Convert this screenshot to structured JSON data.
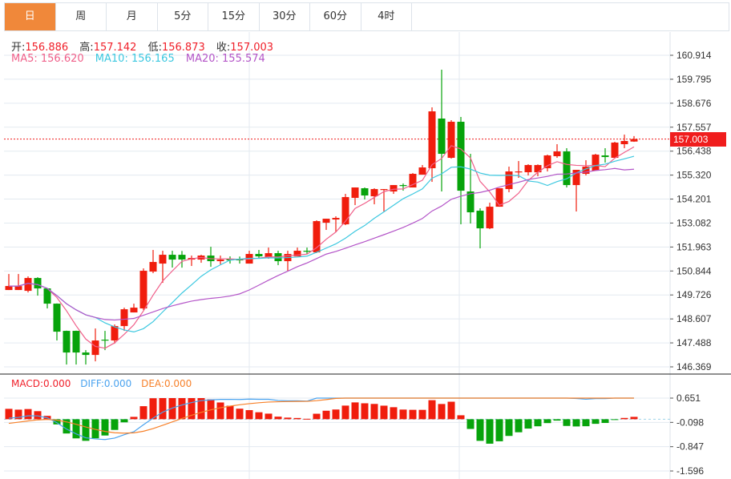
{
  "tabs": [
    {
      "label": "日",
      "active": true
    },
    {
      "label": "周"
    },
    {
      "label": "月"
    },
    {
      "label": "5分"
    },
    {
      "label": "15分"
    },
    {
      "label": "30分"
    },
    {
      "label": "60分"
    },
    {
      "label": "4时"
    }
  ],
  "ohlc": {
    "open_label": "开:",
    "open": "156.886",
    "high_label": "高:",
    "high": "157.142",
    "low_label": "低:",
    "low": "156.873",
    "close_label": "收:",
    "close": "157.003"
  },
  "ma": {
    "ma5": "MA5: 156.620",
    "ma10": "MA10: 156.165",
    "ma20": "MA20: 155.574"
  },
  "macd_legend": {
    "macd": "MACD:0.000",
    "diff": "DIFF:0.000",
    "dea": "DEA:0.000"
  },
  "current_price": "157.003",
  "colors": {
    "up": "#f01d0d",
    "down": "#07a30b",
    "ma5": "#f0608a",
    "ma10": "#3cc8e0",
    "ma20": "#b455c8",
    "diff": "#4aa3ef",
    "dea": "#f7812a",
    "accent": "#f0883a"
  },
  "chart_data": {
    "type": "candlestick",
    "price_axis": {
      "ticks": [
        "160.914",
        "159.795",
        "158.676",
        "157.557",
        "156.438",
        "155.320",
        "154.201",
        "153.082",
        "151.963",
        "150.844",
        "149.726",
        "148.607",
        "147.488",
        "146.369"
      ],
      "range": [
        146.369,
        160.914
      ]
    },
    "macd_axis": {
      "ticks": [
        "0.651",
        "-0.098",
        "-0.847",
        "-1.596"
      ],
      "range": [
        -1.596,
        0.651
      ]
    },
    "candles": [
      [
        149.956,
        150.704,
        149.956,
        150.143
      ],
      [
        149.956,
        150.704,
        149.956,
        150.14
      ],
      [
        149.918,
        150.592,
        149.843,
        150.517
      ],
      [
        150.517,
        150.554,
        149.694,
        150.031
      ],
      [
        150.031,
        150.05,
        149.096,
        149.32
      ],
      [
        149.32,
        149.33,
        147.6,
        148.011
      ],
      [
        148.049,
        148.06,
        146.478,
        147.039
      ],
      [
        148.05,
        148.06,
        146.478,
        147.039
      ],
      [
        147.039,
        147.151,
        146.478,
        146.926
      ],
      [
        146.926,
        148.161,
        146.627,
        147.6
      ],
      [
        147.637,
        148.049,
        147.151,
        147.6
      ],
      [
        147.6,
        148.348,
        147.45,
        148.273
      ],
      [
        148.273,
        149.133,
        148.049,
        149.058
      ],
      [
        148.909,
        149.32,
        148.909,
        149.133
      ],
      [
        149.096,
        150.966,
        149.021,
        150.854
      ],
      [
        150.816,
        151.826,
        150.741,
        151.265
      ],
      [
        151.19,
        151.789,
        150.292,
        151.602
      ],
      [
        151.602,
        151.789,
        151.004,
        151.377
      ],
      [
        151.6,
        151.78,
        151.0,
        151.38
      ],
      [
        151.377,
        151.564,
        151.078,
        151.452
      ],
      [
        151.377,
        151.602,
        151.228,
        151.564
      ],
      [
        151.564,
        151.975,
        151.041,
        151.303
      ],
      [
        151.303,
        151.564,
        151.153,
        151.377
      ],
      [
        151.415,
        151.527,
        151.19,
        151.34
      ],
      [
        151.41,
        151.52,
        151.19,
        151.34
      ],
      [
        151.19,
        151.789,
        151.19,
        151.639
      ],
      [
        151.639,
        151.826,
        151.452,
        151.527
      ],
      [
        151.489,
        151.938,
        151.415,
        151.676
      ],
      [
        151.676,
        151.789,
        151.116,
        151.303
      ],
      [
        151.303,
        151.789,
        150.854,
        151.639
      ],
      [
        151.527,
        151.938,
        151.527,
        151.789
      ],
      [
        151.789,
        151.938,
        151.639,
        151.751
      ],
      [
        151.714,
        153.21,
        151.68,
        153.172
      ],
      [
        153.097,
        153.284,
        152.761,
        153.284
      ],
      [
        153.247,
        153.397,
        152.649,
        153.322
      ],
      [
        153.023,
        154.444,
        152.985,
        154.294
      ],
      [
        154.257,
        154.743,
        153.92,
        154.743
      ],
      [
        154.706,
        154.743,
        154.182,
        154.369
      ],
      [
        154.332,
        154.706,
        153.958,
        154.668
      ],
      [
        154.631,
        154.668,
        153.621,
        154.668
      ],
      [
        154.556,
        154.855,
        154.444,
        154.855
      ],
      [
        154.855,
        154.93,
        154.593,
        154.818
      ],
      [
        154.743,
        155.416,
        154.743,
        155.379
      ],
      [
        155.341,
        155.79,
        155.341,
        155.678
      ],
      [
        155.641,
        158.483,
        155.005,
        158.296
      ],
      [
        157.96,
        160.241,
        154.556,
        156.314
      ],
      [
        156.127,
        157.885,
        156.089,
        157.81
      ],
      [
        157.81,
        158.034,
        153.023,
        154.593
      ],
      [
        154.556,
        156.314,
        153.06,
        153.584
      ],
      [
        153.658,
        153.771,
        151.901,
        152.836
      ],
      [
        152.836,
        154.032,
        152.798,
        153.845
      ],
      [
        153.845,
        154.706,
        153.845,
        154.706
      ],
      [
        154.668,
        155.715,
        154.519,
        155.491
      ],
      [
        155.454,
        155.977,
        155.192,
        155.491
      ],
      [
        155.454,
        155.828,
        155.304,
        155.79
      ],
      [
        155.45,
        155.82,
        155.27,
        155.79
      ],
      [
        155.641,
        156.276,
        155.491,
        156.239
      ],
      [
        156.202,
        156.763,
        156.127,
        156.426
      ],
      [
        156.426,
        156.576,
        154.743,
        154.855
      ],
      [
        154.855,
        155.566,
        153.621,
        155.566
      ],
      [
        155.379,
        156.015,
        155.304,
        155.715
      ],
      [
        155.528,
        156.314,
        155.528,
        156.276
      ],
      [
        156.239,
        156.576,
        155.902,
        156.164
      ],
      [
        156.127,
        156.875,
        156.127,
        156.838
      ],
      [
        156.763,
        157.211,
        156.576,
        156.912
      ],
      [
        156.886,
        157.142,
        156.873,
        157.003
      ]
    ]
  }
}
